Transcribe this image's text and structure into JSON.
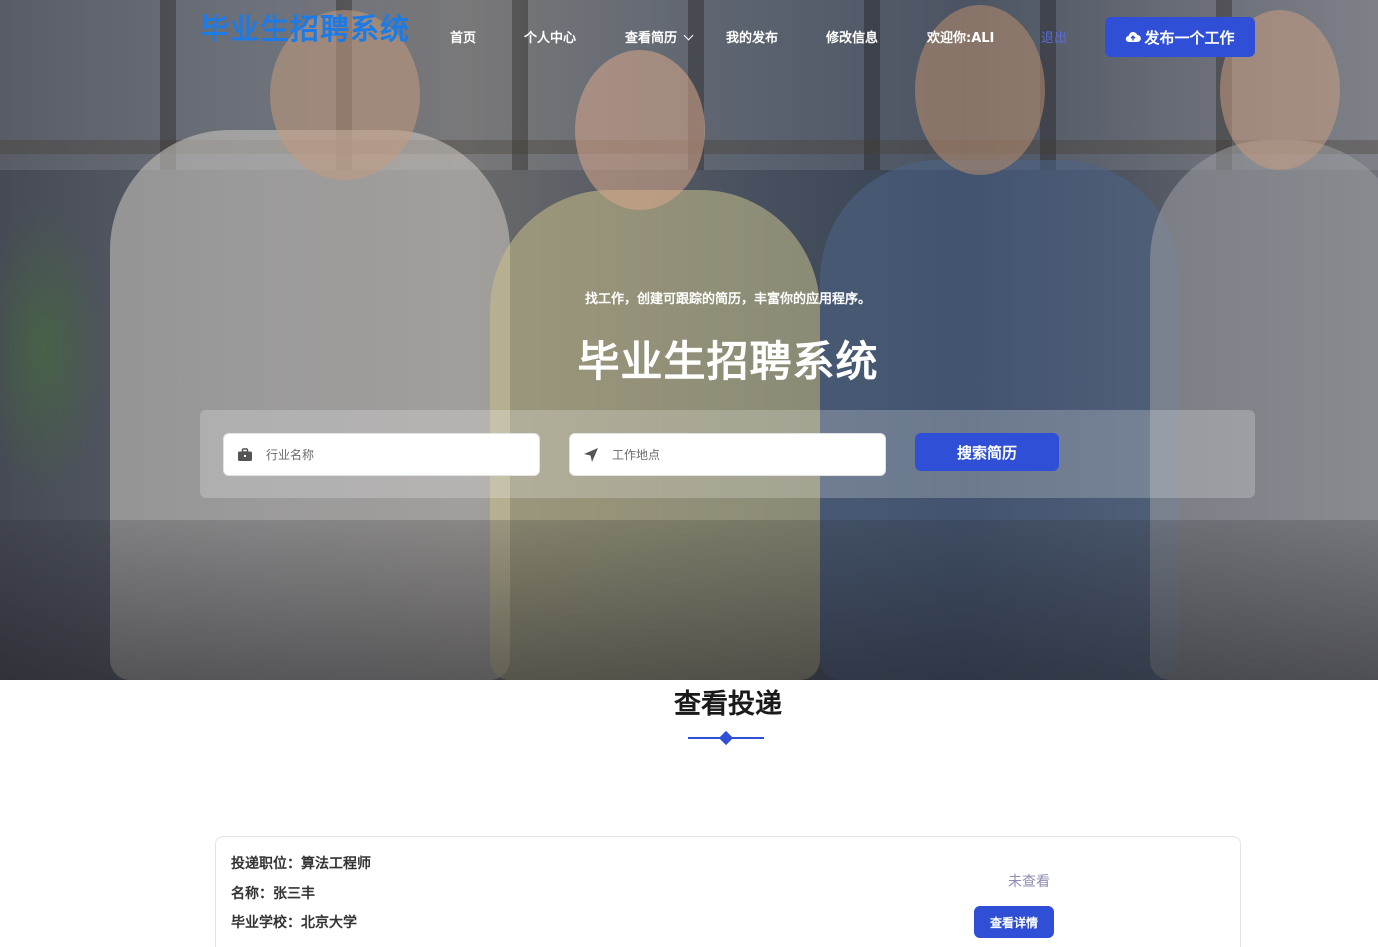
{
  "brand": {
    "logo": "毕业生招聘系统",
    "accent_color": "#2e4fd6",
    "logo_color": "#1e7be6"
  },
  "nav": {
    "items": [
      {
        "label": "首页"
      },
      {
        "label": "个人中心"
      },
      {
        "label": "查看简历",
        "has_dropdown": true
      },
      {
        "label": "我的发布"
      },
      {
        "label": "修改信息"
      },
      {
        "label": "欢迎你:ALI"
      },
      {
        "label": "退出"
      }
    ],
    "post_button": {
      "label": "发布一个工作",
      "icon": "cloud-upload-icon"
    }
  },
  "hero": {
    "tagline": "找工作，创建可跟踪的简历，丰富你的应用程序。",
    "title": "毕业生招聘系统"
  },
  "search": {
    "industry": {
      "placeholder": "行业名称",
      "value": "",
      "icon": "briefcase-icon"
    },
    "location": {
      "placeholder": "工作地点",
      "value": "",
      "icon": "location-arrow-icon"
    },
    "button_label": "搜索简历"
  },
  "section": {
    "title": "查看投递"
  },
  "applications": [
    {
      "position_label": "投递职位：",
      "position": "算法工程师",
      "name_label": "名称：",
      "name": "张三丰",
      "school_label": "毕业学校：",
      "school": "北京大学",
      "status": "未查看",
      "detail_button": "查看详情"
    }
  ]
}
